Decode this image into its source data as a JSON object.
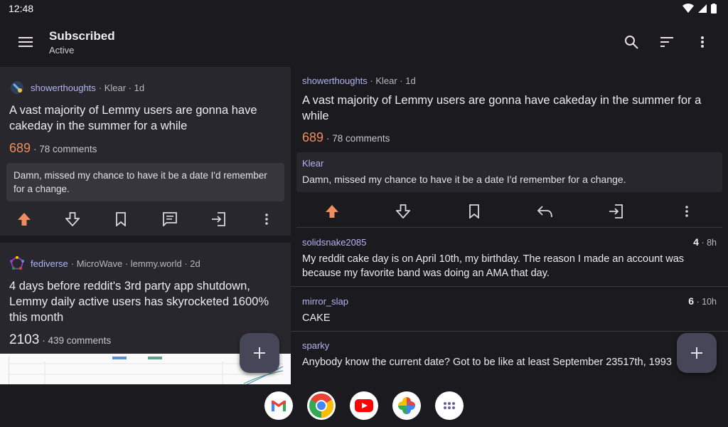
{
  "status": {
    "time": "12:48"
  },
  "app_bar": {
    "title": "Subscribed",
    "subtitle": "Active"
  },
  "left_posts": [
    {
      "community": "showerthoughts",
      "meta": "· Klear · 1d",
      "title": "A vast majority of Lemmy users are gonna have cakeday in the summer for a while",
      "score": "689",
      "comments": "· 78 comments",
      "preview": "Damn, missed my chance to have it be a date I'd remember for a change."
    },
    {
      "community": "fediverse",
      "meta": "· MicroWave · lemmy.world · 2d",
      "title": "4 days before reddit's 3rd party app shutdown, Lemmy daily active users has skyrocketed 1600% this month",
      "score": "2103",
      "comments": "· 439 comments"
    }
  ],
  "detail": {
    "community": "showerthoughts",
    "meta": "· Klear · 1d",
    "title": "A vast majority of Lemmy users are gonna have cakeday in the summer for a while",
    "score": "689",
    "comments": "· 78 comments",
    "quote_author": "Klear",
    "quote_body": "Damn, missed my chance to have it be a date I'd remember for a change."
  },
  "comments": [
    {
      "user": "solidsnake2085",
      "score": "4",
      "age": "· 8h",
      "body": "My reddit cake day is on April 10th, my birthday. The reason I made an account was because my favorite band was doing an AMA that day."
    },
    {
      "user": "mirror_slap",
      "score": "6",
      "age": "· 10h",
      "body": "CAKE"
    },
    {
      "user": "sparky",
      "score": "",
      "age": "",
      "body": "Anybody know the current date? Got to be like at least September 23517th, 1993"
    }
  ],
  "colors": {
    "accent_upvote": "#f08d5e",
    "link": "#b3b4f0",
    "background": "#1b1a1f",
    "card": "#28272d"
  }
}
